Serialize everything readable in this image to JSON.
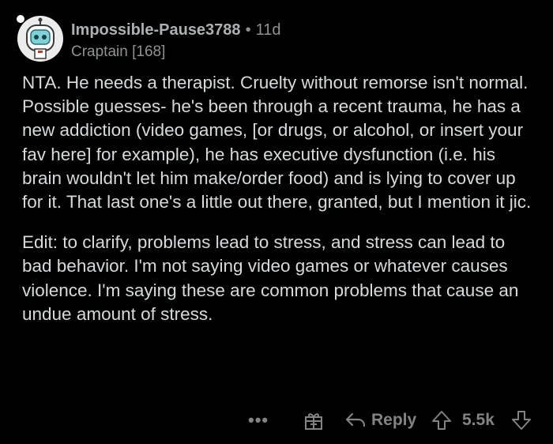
{
  "comment": {
    "author": "Impossible-Pause3788",
    "separator": "•",
    "age": "11d",
    "flair": "Craptain [168]",
    "paragraphs": [
      "NTA. He needs a therapist. Cruelty without remorse isn't normal. Possible guesses- he's been through a recent trauma, he has a new addiction (video games, [or drugs, or alcohol, or insert your fav here] for example), he has executive dysfunction (i.e. his brain wouldn't let him make/order food) and is lying to cover up for it. That last one's a little out there, granted, but I mention it jic.",
      "Edit: to clarify, problems lead to stress, and stress can lead to bad behavior. I'm not saying video games or whatever causes violence. I'm saying these are common problems that cause an undue amount of stress."
    ]
  },
  "actions": {
    "more_label": "•••",
    "reply_label": "Reply",
    "score": "5.5k",
    "icons": {
      "avatar": "snoo-avatar-icon",
      "award": "gift-icon",
      "reply": "reply-arrow-icon",
      "upvote": "upvote-arrow-icon",
      "downvote": "downvote-arrow-icon"
    }
  },
  "colors": {
    "background": "#000000",
    "body_text": "#d7dadc",
    "meta_text": "#8f9294",
    "action_text": "#818384"
  }
}
